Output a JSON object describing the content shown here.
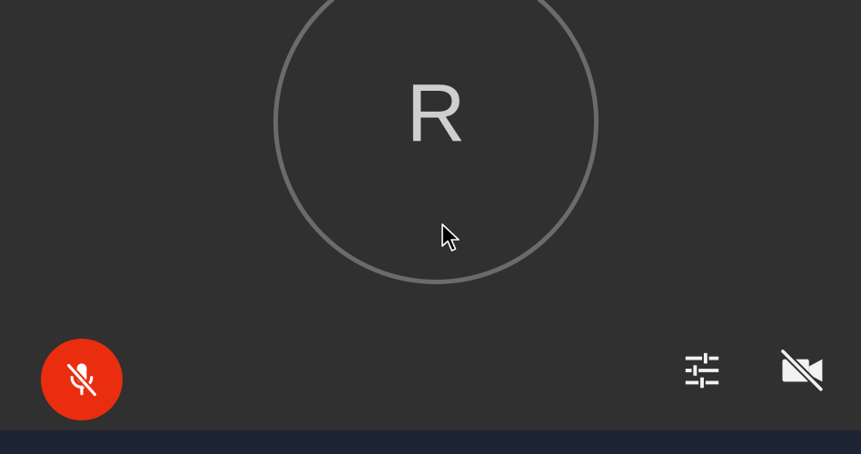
{
  "participant": {
    "initial": "R"
  },
  "controls": {
    "microphone": {
      "icon": "mic-off-icon",
      "state": "muted",
      "color": "#ea2d0f"
    },
    "settings": {
      "icon": "sliders-icon"
    },
    "camera": {
      "icon": "video-off-icon",
      "state": "off"
    }
  },
  "colors": {
    "background": "#303030",
    "ring": "#6b6b6b",
    "initial": "#cfcfcf",
    "bottom_bar": "#1c2433"
  }
}
